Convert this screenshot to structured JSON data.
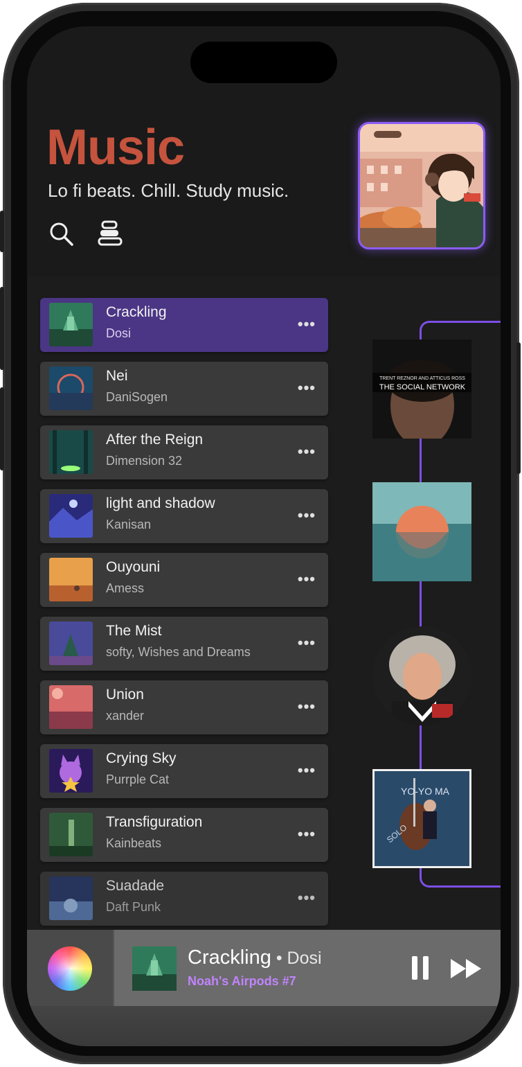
{
  "header": {
    "title": "Music",
    "subtitle": "Lo fi beats. Chill. Study music."
  },
  "tracks": [
    {
      "title": "Crackling",
      "artist": "Dosi",
      "active": true
    },
    {
      "title": "Nei",
      "artist": "DaniSogen"
    },
    {
      "title": "After the Reign",
      "artist": "Dimension 32"
    },
    {
      "title": "light and shadow",
      "artist": "Kanisan"
    },
    {
      "title": "Ouyouni",
      "artist": "Amess"
    },
    {
      "title": "The Mist",
      "artist": "softy, Wishes and Dreams"
    },
    {
      "title": "Union",
      "artist": "xander"
    },
    {
      "title": "Crying Sky",
      "artist": "Purrple Cat"
    },
    {
      "title": "Transfiguration",
      "artist": "Kainbeats"
    },
    {
      "title": "Suadade",
      "artist": "Daft Punk"
    }
  ],
  "more_label": "•••",
  "albums": [
    {
      "line1": "TRENT REZNOR AND ATTICUS ROSS",
      "line2": "THE SOCIAL NETWORK"
    },
    {
      "line1": ""
    },
    {
      "line1": ""
    },
    {
      "line1": "YO-YO MA",
      "line2": "SOLO"
    }
  ],
  "now_playing": {
    "title": "Crackling",
    "separator": " • ",
    "artist": "Dosi",
    "device": "Noah's Airpods #7"
  },
  "colors": {
    "accent": "#8b5cf6",
    "title": "#c5533d",
    "active_row": "#4b3585",
    "device": "#c084fc"
  }
}
